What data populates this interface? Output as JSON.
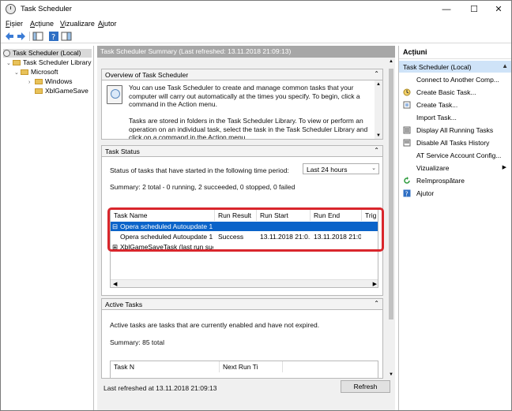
{
  "window": {
    "title": "Task Scheduler"
  },
  "menu": [
    {
      "u": "F",
      "rest": "ișier"
    },
    {
      "u": "A",
      "rest": "cțiune"
    },
    {
      "u": "V",
      "rest": "izualizare"
    },
    {
      "u": "A",
      "rest": "jutor"
    }
  ],
  "tree": {
    "root": "Task Scheduler (Local)",
    "library": "Task Scheduler Library",
    "microsoft": "Microsoft",
    "windows": "Windows",
    "xbl": "XblGameSave"
  },
  "center": {
    "header": "Task Scheduler Summary (Last refreshed: 13.11.2018 21:09:13)",
    "overview": {
      "title": "Overview of Task Scheduler",
      "p1": [
        "You can use Task Scheduler to create and manage common tasks that your",
        "computer will carry out automatically at the times you specify. To begin, click a",
        "command in the Action menu."
      ],
      "p2": [
        "Tasks are stored in folders in the Task Scheduler Library. To view or perform an",
        "operation on an individual task, select the task in the Task Scheduler Library and",
        "click on a command in the Action menu."
      ]
    },
    "status": {
      "title": "Task Status",
      "period_label": "Status of tasks that have started in the following time period:",
      "period_value": "Last 24 hours",
      "summary": "Summary: 2 total - 0 running, 2 succeeded, 0 stopped, 0 failed",
      "columns": [
        "Task Name",
        "Run Result",
        "Run Start",
        "Run End",
        "Trig"
      ],
      "rows": [
        {
          "expander": "⊟",
          "name": "Opera scheduled Autoupdate 1...",
          "result": "",
          "start": "",
          "end": ""
        },
        {
          "expander": "",
          "name": "Opera scheduled Autoupdate 1...",
          "result": "Success",
          "start": "13.11.2018 21:0...",
          "end": "13.11.2018 21:0..."
        },
        {
          "expander": "⊞",
          "name": "XblGameSaveTask (last run suc...",
          "result": "",
          "start": "",
          "end": ""
        }
      ]
    },
    "active": {
      "title": "Active Tasks",
      "desc": "Active tasks are tasks that are currently enabled and have not expired.",
      "summary": "Summary: 85 total",
      "col1": "Task N",
      "col2": "Next Run Ti"
    },
    "footer": {
      "last_refreshed": "Last refreshed at 13.11.2018 21:09:13",
      "refresh": "Refresh"
    }
  },
  "actions": {
    "title": "Acțiuni",
    "group": "Task Scheduler (Local)",
    "items": [
      {
        "label": "Connect to Another Comp...",
        "icon": "computer-icon"
      },
      {
        "label": "Create Basic Task...",
        "icon": "basic-task-icon"
      },
      {
        "label": "Create Task...",
        "icon": "create-task-icon"
      },
      {
        "label": "Import Task...",
        "icon": "import-icon"
      },
      {
        "label": "Display All Running Tasks",
        "icon": "running-tasks-icon"
      },
      {
        "label": "Disable All Tasks History",
        "icon": "history-icon"
      },
      {
        "label": "AT Service Account Config...",
        "icon": "account-icon"
      },
      {
        "label": "Vizualizare",
        "icon": "view-icon",
        "submenu": "▶"
      },
      {
        "label": "Reîmprospătare",
        "icon": "refresh-icon"
      },
      {
        "label": "Ajutor",
        "icon": "help-icon"
      }
    ]
  }
}
